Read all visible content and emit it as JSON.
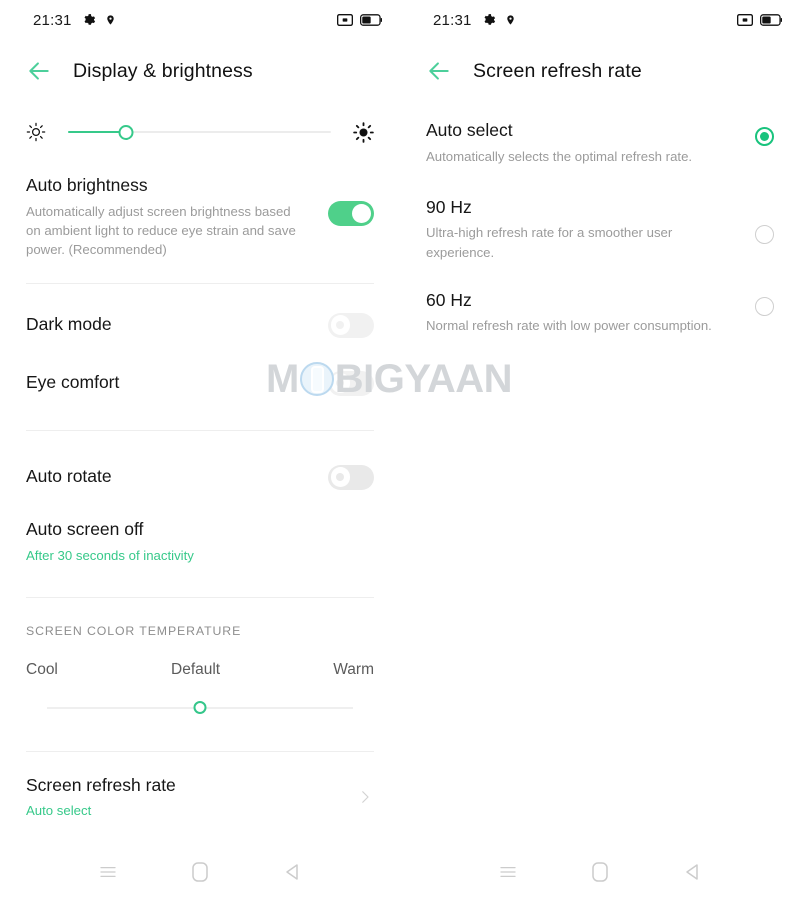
{
  "status_bar": {
    "time": "21:31",
    "left_icons": [
      "gear-icon",
      "location-pin-icon"
    ],
    "right_icons": [
      "cast-icon",
      "battery-icon"
    ]
  },
  "colors": {
    "accent_green": "#36c98a",
    "toggle_on": "#4fd08a",
    "toggle_off": "#e9e9e9",
    "radio_on": "#19c37d",
    "title_text": "#161616",
    "sub_text": "#9b9b9b",
    "divider": "#eeeeee"
  },
  "watermark": {
    "text_before": "M",
    "text_after": "BIGYAAN",
    "icon": "phone-in-circle-icon"
  },
  "left_screen": {
    "title": "Display & brightness",
    "back_icon": "back-arrow-icon",
    "brightness_slider": {
      "low_icon": "sun-outline-icon",
      "high_icon": "sun-filled-icon",
      "value_percent": 22
    },
    "rows": [
      {
        "name": "auto-brightness",
        "title": "Auto brightness",
        "subtitle": "Automatically adjust screen brightness based on ambient light to reduce eye strain and save power. (Recommended)",
        "toggle": "on"
      },
      {
        "name": "dark-mode",
        "title": "Dark mode",
        "subtitle": "",
        "toggle": "off"
      },
      {
        "name": "eye-comfort",
        "title": "Eye comfort",
        "subtitle": "",
        "toggle": "off"
      },
      {
        "name": "auto-rotate",
        "title": "Auto rotate",
        "subtitle": "",
        "toggle": "off"
      },
      {
        "name": "auto-screen-off",
        "title": "Auto screen off",
        "subtitle": "After 30 seconds of inactivity",
        "toggle": "none"
      }
    ],
    "color_temperature": {
      "section_label": "SCREEN COLOR TEMPERATURE",
      "left_label": "Cool",
      "center_label": "Default",
      "right_label": "Warm",
      "value_percent": 50
    },
    "refresh_rate_row": {
      "title": "Screen refresh rate",
      "value": "Auto select",
      "chevron_icon": "chevron-right-icon"
    }
  },
  "right_screen": {
    "title": "Screen refresh rate",
    "back_icon": "back-arrow-icon",
    "options": [
      {
        "name": "auto-select",
        "title": "Auto select",
        "subtitle": "Automatically selects the optimal refresh rate.",
        "selected": true
      },
      {
        "name": "90hz",
        "title": "90 Hz",
        "subtitle": "Ultra-high refresh rate for a smoother user experience.",
        "selected": false
      },
      {
        "name": "60hz",
        "title": "60 Hz",
        "subtitle": "Normal refresh rate with low power consumption.",
        "selected": false
      }
    ]
  },
  "nav_bar": {
    "buttons": [
      "recents-icon",
      "home-icon",
      "back-icon"
    ]
  }
}
